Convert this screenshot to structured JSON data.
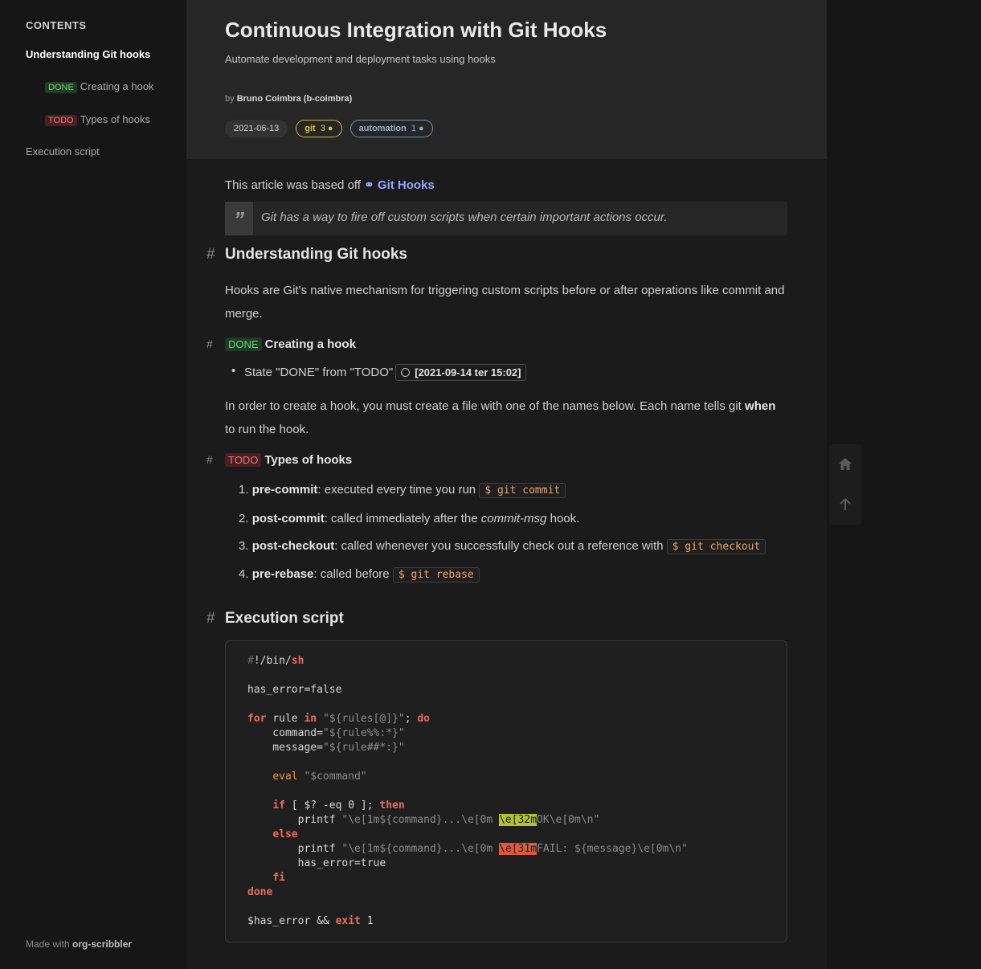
{
  "toc": {
    "title": "CONTENTS",
    "items": [
      {
        "label": "Understanding Git hooks"
      },
      {
        "tag": "DONE",
        "label": "Creating a hook"
      },
      {
        "tag": "TODO",
        "label": "Types of hooks"
      },
      {
        "label": "Execution script"
      }
    ]
  },
  "footer": {
    "made_with": "Made with",
    "tool": "org-scribbler"
  },
  "header": {
    "title": "Continuous Integration with Git Hooks",
    "subtitle": "Automate development and deployment tasks using hooks",
    "by": "by",
    "author": "Bruno Coimbra (b-coimbra)",
    "date": "2021-06-13",
    "tags": [
      {
        "name": "git",
        "count": "3"
      },
      {
        "name": "automation",
        "count": "1"
      }
    ]
  },
  "article": {
    "based_off": "This article was based off",
    "link_label": "Git Hooks",
    "quote": "Git has a way to fire off custom scripts when certain important actions occur.",
    "hash": "#",
    "s1_title": "Understanding Git hooks",
    "s1_text": "Hooks are Git's native mechanism for triggering custom scripts before or after operations like commit and merge.",
    "s2_tag": "DONE",
    "s2_title": "Creating a hook",
    "s2_state": "State \"DONE\" from \"TODO\"",
    "s2_timestamp": "[2021-09-14 ter 15:02]",
    "s2_text_a": "In order to create a hook, you must create a file with one of the names below. Each name tells git",
    "s2_text_when": "when",
    "s2_text_b": "to run the hook.",
    "s3_tag": "TODO",
    "s3_title": "Types of hooks",
    "hooks": [
      {
        "num": "1.",
        "name": "pre-commit",
        "desc": ": executed every time you run",
        "code": "$ git commit"
      },
      {
        "num": "2.",
        "name": "post-commit",
        "desc": ": called immediately after the",
        "em": "commit-msg",
        "after": "hook."
      },
      {
        "num": "3.",
        "name": "post-checkout",
        "desc": ": called whenever you successfully check out a reference with",
        "code": "$ git checkout"
      },
      {
        "num": "4.",
        "name": "pre-rebase",
        "desc": ": called before",
        "code": "$ git rebase"
      }
    ],
    "s4_title": "Execution script"
  }
}
